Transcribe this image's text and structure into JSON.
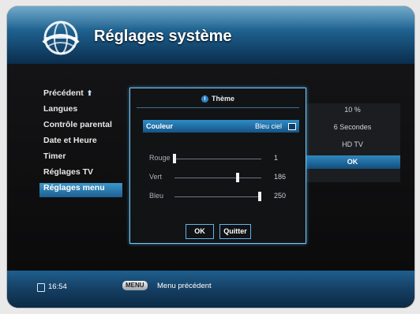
{
  "header": {
    "title": "Réglages système"
  },
  "menu": {
    "items": [
      {
        "label": "Précédent",
        "icon": "arrow-up-icon"
      },
      {
        "label": "Langues"
      },
      {
        "label": "Contrôle parental"
      },
      {
        "label": "Date et Heure"
      },
      {
        "label": "Timer"
      },
      {
        "label": "Réglages TV"
      },
      {
        "label": "Réglages menu"
      }
    ],
    "active_index": 6
  },
  "values": [
    {
      "text": "10 %"
    },
    {
      "text": "6 Secondes"
    },
    {
      "text": "HD TV"
    },
    {
      "text": "OK"
    }
  ],
  "dialog": {
    "title": "Thème",
    "color_label": "Couleur",
    "color_value": "Bleu ciel",
    "sliders": [
      {
        "label": "Rouge",
        "value": "1",
        "level": 1
      },
      {
        "label": "Vert",
        "value": "186",
        "level": 186
      },
      {
        "label": "Bleu",
        "value": "250",
        "level": 250
      }
    ],
    "ok_label": "OK",
    "quit_label": "Quitter"
  },
  "footer": {
    "time": "16:54",
    "menu_key": "MENU",
    "hint": "Menu précédent"
  },
  "colors": {
    "accent": "#2f8cc6",
    "background": "#0b0b0c"
  }
}
